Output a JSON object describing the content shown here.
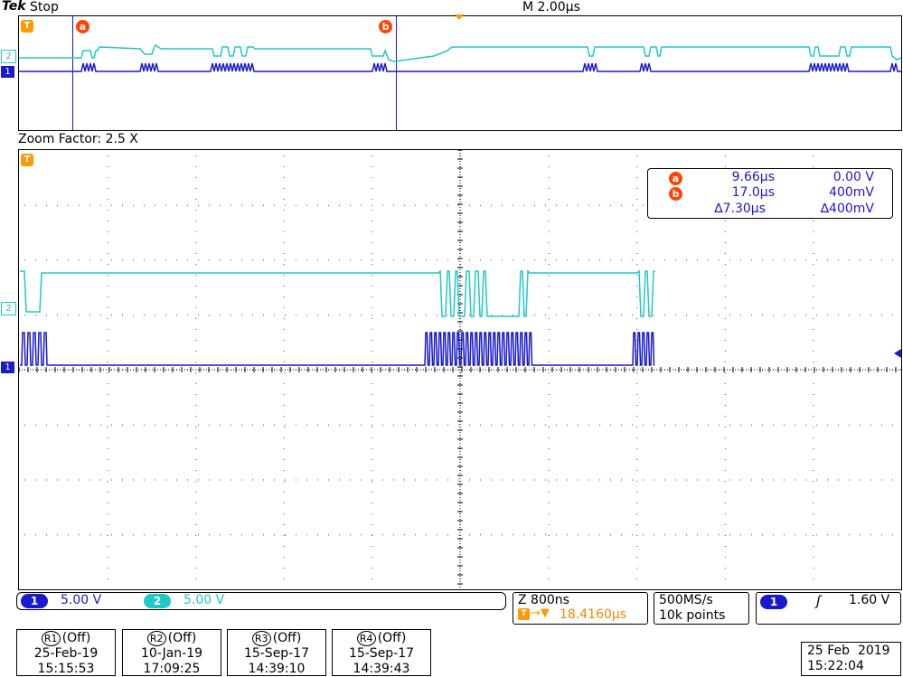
{
  "header": {
    "brand": "Tek",
    "state": "Stop",
    "timebase": "M 2.00µs"
  },
  "markers": {
    "trigger": "T",
    "cursor_a": "a",
    "cursor_b": "b",
    "ch1": "1",
    "ch2": "2"
  },
  "zoom": {
    "label": "Zoom Factor: 2.5 X"
  },
  "cursor_readout": {
    "a_time": "9.66µs",
    "a_volt": "0.00 V",
    "b_time": "17.0µs",
    "b_volt": "400mV",
    "delta_time": "∆7.30µs",
    "delta_volt": "∆400mV"
  },
  "channels": {
    "ch1": {
      "label": "1",
      "scale": "5.00 V",
      "color": "#1a1acc"
    },
    "ch2": {
      "label": "2",
      "scale": "5.00 V",
      "color": "#22c8c8"
    }
  },
  "zoom_info": {
    "scale": "Z 800ns",
    "position": "18.4160µs"
  },
  "acq": {
    "rate": "500MS/s",
    "points": "10k points"
  },
  "trigger": {
    "source": "1",
    "slope": "ʃ",
    "level": "1.60 V"
  },
  "refs": [
    {
      "id": "R1",
      "state": "(Off)",
      "date": "25-Feb-19",
      "time": "15:15:53"
    },
    {
      "id": "R2",
      "state": "(Off)",
      "date": "10-Jan-19",
      "time": "17:09:25"
    },
    {
      "id": "R3",
      "state": "(Off)",
      "date": "15-Sep-17",
      "time": "14:39:10"
    },
    {
      "id": "R4",
      "state": "(Off)",
      "date": "15-Sep-17",
      "time": "14:39:43"
    }
  ],
  "datetime": {
    "date": "25 Feb  2019",
    "time": "15:22:04"
  },
  "colors": {
    "cursor_marker": "#ff4400",
    "trigger_orange": "#ff9900",
    "readout_orange": "#ee8800"
  }
}
